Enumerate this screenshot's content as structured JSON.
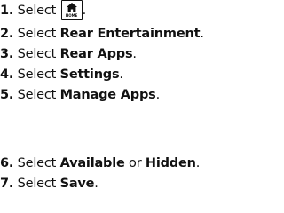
{
  "steps": [
    {
      "num": "1.",
      "prefix": "Select ",
      "icon": "home-icon",
      "icon_caption": "HOME",
      "suffix": "."
    },
    {
      "num": "2.",
      "prefix": "Select ",
      "bold": "Rear Entertainment",
      "suffix": "."
    },
    {
      "num": "3.",
      "prefix": "Select ",
      "bold": "Rear Apps",
      "suffix": "."
    },
    {
      "num": "4.",
      "prefix": "Select ",
      "bold": "Settings",
      "suffix": "."
    },
    {
      "num": "5.",
      "prefix": "Select ",
      "bold": "Manage Apps",
      "suffix": "."
    },
    {
      "num": "6.",
      "prefix": "Select ",
      "bold": "Available",
      "middle": " or ",
      "bold2": "Hidden",
      "suffix": "."
    },
    {
      "num": "7.",
      "prefix": "Select ",
      "bold": "Save",
      "suffix": "."
    }
  ]
}
